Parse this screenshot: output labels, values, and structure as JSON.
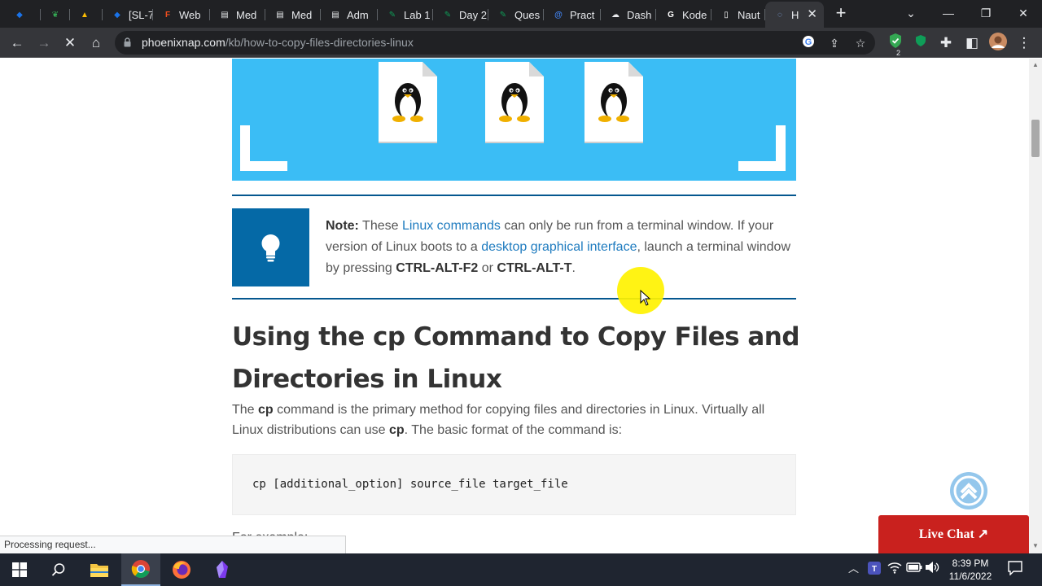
{
  "browser": {
    "tabs": [
      {
        "label": "",
        "color": "#1a73e8",
        "glyph": "◆"
      },
      {
        "label": "",
        "color": "#34a853",
        "glyph": "❦"
      },
      {
        "label": "",
        "color": "#fbbc04",
        "glyph": "▲"
      },
      {
        "label": "[SL-7",
        "color": "#1a73e8",
        "glyph": "◆"
      },
      {
        "label": "Web",
        "color": "#f24e1e",
        "glyph": "F"
      },
      {
        "label": "Med",
        "color": "#e8eaed",
        "glyph": "▤"
      },
      {
        "label": "Med",
        "color": "#e8eaed",
        "glyph": "▤"
      },
      {
        "label": "Adm",
        "color": "#e8eaed",
        "glyph": "▤"
      },
      {
        "label": "Lab 1",
        "color": "#0f9d58",
        "glyph": "✎"
      },
      {
        "label": "Day 2",
        "color": "#0f9d58",
        "glyph": "✎"
      },
      {
        "label": "Ques",
        "color": "#0f9d58",
        "glyph": "✎"
      },
      {
        "label": "Pract",
        "color": "#4285f4",
        "glyph": "@"
      },
      {
        "label": "Dash",
        "color": "#e8eaed",
        "glyph": "☁"
      },
      {
        "label": "Kode",
        "color": "#ffffff",
        "glyph": "G"
      },
      {
        "label": "Naut",
        "color": "#ffffff",
        "glyph": "▯"
      },
      {
        "label": "H",
        "color": "#8ab4f8",
        "glyph": "◌"
      }
    ],
    "url_host": "phoenixnap.com",
    "url_path": "/kb/how-to-copy-files-directories-linux",
    "status_text": "Processing request...",
    "profile_badge": "2"
  },
  "article": {
    "note": {
      "lead": "Note:",
      "t1": " These ",
      "link1": "Linux commands",
      "t2": " can only be run from a terminal window. If your version of Linux boots to a ",
      "link2": "desktop graphical interface",
      "t3": ", launch a terminal window by pressing ",
      "key1": "CTRL-ALT-F2",
      "t4": " or ",
      "key2": "CTRL-ALT-T",
      "t5": "."
    },
    "heading": "Using the cp Command to Copy Files and Directories in Linux",
    "para": {
      "t1": "The ",
      "cmd1": "cp",
      "t2": " command is the primary method for copying files and directories in Linux. Virtually all Linux distributions can use ",
      "cmd2": "cp",
      "t3": ". The basic format of the command is:"
    },
    "code": "cp [additional_option] source_file target_file",
    "cutoff": "For example:"
  },
  "widgets": {
    "live_chat": "Live Chat ↗"
  },
  "taskbar": {
    "time": "8:39 PM",
    "date": "11/6/2022"
  },
  "colors": {
    "hero": "#3bbdf5",
    "note_box": "#0569a6",
    "link": "#1e7bbf",
    "live_chat": "#c9211e"
  }
}
